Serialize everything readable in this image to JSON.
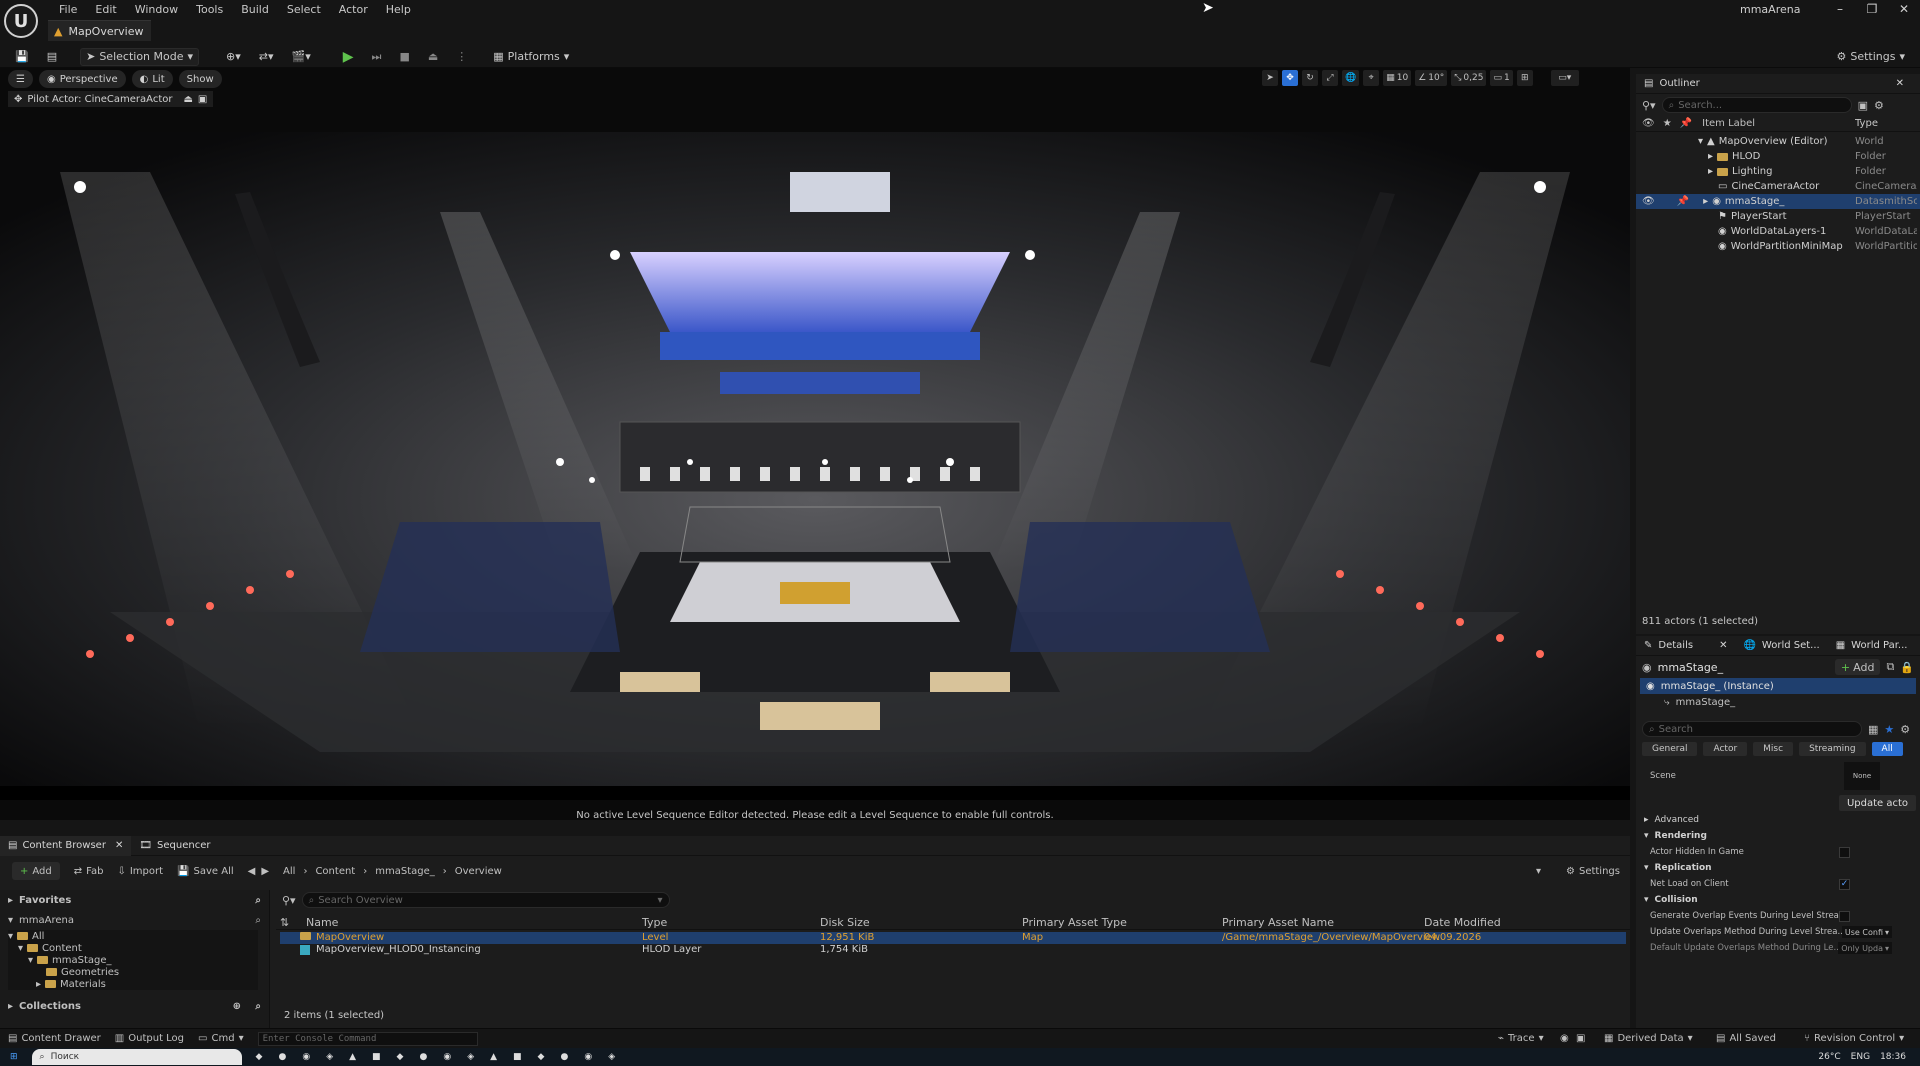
{
  "window": {
    "title": "mmaArena",
    "menu": [
      "File",
      "Edit",
      "Window",
      "Tools",
      "Build",
      "Select",
      "Actor",
      "Help"
    ],
    "map_tab": "MapOverview",
    "controls": [
      "–",
      "❐",
      "✕"
    ]
  },
  "toolbar": {
    "selection_mode": "Selection Mode",
    "platforms": "Platforms",
    "settings": "Settings"
  },
  "viewport": {
    "perspective": "Perspective",
    "lit": "Lit",
    "show": "Show",
    "pilot_actor": "Pilot Actor: CineCameraActor",
    "grid_snap": "10",
    "rotation_snap": "10°",
    "scale_snap": "0,25",
    "camera_speed": "1",
    "sequence_message": "No active Level Sequence Editor detected. Please edit a Level Sequence to enable full controls."
  },
  "outliner": {
    "tab": "Outliner",
    "search_placeholder": "Search...",
    "col_label": "Item Label",
    "col_type": "Type",
    "items": [
      {
        "label": "MapOverview (Editor)",
        "type": "World"
      },
      {
        "label": "HLOD",
        "type": "Folder"
      },
      {
        "label": "Lighting",
        "type": "Folder"
      },
      {
        "label": "CineCameraActor",
        "type": "CineCameraA"
      },
      {
        "label": "mmaStage_",
        "type": "DatasmithSc"
      },
      {
        "label": "PlayerStart",
        "type": "PlayerStart"
      },
      {
        "label": "WorldDataLayers-1",
        "type": "WorldDataLa"
      },
      {
        "label": "WorldPartitionMiniMap",
        "type": "WorldPartitio"
      }
    ],
    "count": "811 actors (1 selected)"
  },
  "details": {
    "tabs": [
      "Details",
      "World Set...",
      "World Par..."
    ],
    "actor_name": "mmaStage_",
    "add_label": "Add",
    "instance": "mmaStage_ (Instance)",
    "component": "mmaStage_",
    "search_placeholder": "Search",
    "categories": [
      "General",
      "Actor",
      "Misc",
      "Streaming",
      "All"
    ],
    "scene_label": "Scene",
    "scene_value": "None",
    "update_actor": "Update acto",
    "advanced": "Advanced",
    "rendering": "Rendering",
    "actor_hidden": "Actor Hidden In Game",
    "replication": "Replication",
    "net_load": "Net Load on Client",
    "collision": "Collision",
    "gen_overlap": "Generate Overlap Events During Level Strea...",
    "update_overlap": "Update Overlaps Method During Level Strea...",
    "update_overlap_value": "Use Confi",
    "default_overlap": "Default Update Overlaps Method During Le...",
    "default_overlap_value": "Only Upda"
  },
  "content_browser": {
    "tab": "Content Browser",
    "sequencer": "Sequencer",
    "add": "Add",
    "fab": "Fab",
    "import": "Import",
    "save_all": "Save All",
    "path": [
      "All",
      "Content",
      "mmaStage_",
      "Overview"
    ],
    "settings": "Settings",
    "favorites": "Favorites",
    "project": "mmaArena",
    "tree": [
      "All",
      "Content",
      "mmaStage_",
      "Geometries",
      "Materials"
    ],
    "collections": "Collections",
    "search_placeholder": "Search Overview",
    "columns": [
      "Name",
      "Type",
      "Disk Size",
      "Primary Asset Type",
      "Primary Asset Name",
      "Date Modified"
    ],
    "rows": [
      {
        "name": "MapOverview",
        "type": "Level",
        "size": "12,951 KiB",
        "ptype": "Map",
        "pname": "/Game/mmaStage_/Overview/MapOverview",
        "date": "04.09.2026"
      },
      {
        "name": "MapOverview_HLOD0_Instancing",
        "type": "HLOD Layer",
        "size": "1,754 KiB",
        "ptype": "",
        "pname": "",
        "date": ""
      }
    ],
    "count": "2 items (1 selected)"
  },
  "statusbar": {
    "content_drawer": "Content Drawer",
    "output_log": "Output Log",
    "cmd": "Cmd",
    "console_placeholder": "Enter Console Command",
    "trace": "Trace",
    "derived_data": "Derived Data",
    "all_saved": "All Saved",
    "revision_control": "Revision Control"
  },
  "taskbar": {
    "search": "Поиск",
    "temp": "26°C",
    "lang": "ENG",
    "time": "18:36"
  },
  "colors": {
    "accent": "#2a6fd4",
    "selection": "#1f3f6e",
    "play_green": "#5fc24d",
    "folder": "#c9a24a"
  }
}
